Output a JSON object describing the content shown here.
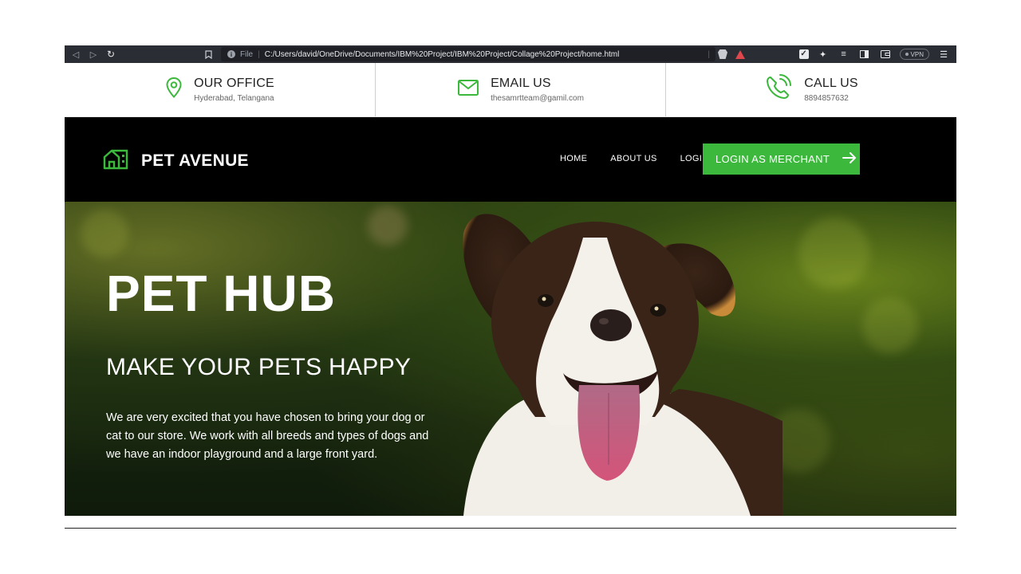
{
  "browser": {
    "url_scheme": "File",
    "url": "C:/Users/david/OneDrive/Documents/IBM%20Project/IBM%20Project/Collage%20Project/home.html",
    "vpn_label": "VPN"
  },
  "contact": [
    {
      "title": "OUR OFFICE",
      "sub": "Hyderabad, Telangana",
      "icon": "location-pin-icon"
    },
    {
      "title": "EMAIL US",
      "sub": "thesamrtteam@gamil.com",
      "icon": "envelope-icon"
    },
    {
      "title": "CALL US",
      "sub": "8894857632",
      "icon": "phone-icon"
    }
  ],
  "navbar": {
    "brand": "PET AVENUE",
    "links": [
      "HOME",
      "ABOUT US",
      "LOGIN"
    ],
    "cta": "LOGIN AS MERCHANT"
  },
  "hero": {
    "title": "PET HUB",
    "tagline": "MAKE YOUR PETS HAPPY",
    "description": "We are very excited that you have chosen to bring your dog or cat to our store. We work with all breeds and types of dogs and we have an indoor playground and a large front yard."
  },
  "colors": {
    "accent": "#3cb83c",
    "navbar_bg": "#000000",
    "browser_bg": "#2b2d35"
  }
}
